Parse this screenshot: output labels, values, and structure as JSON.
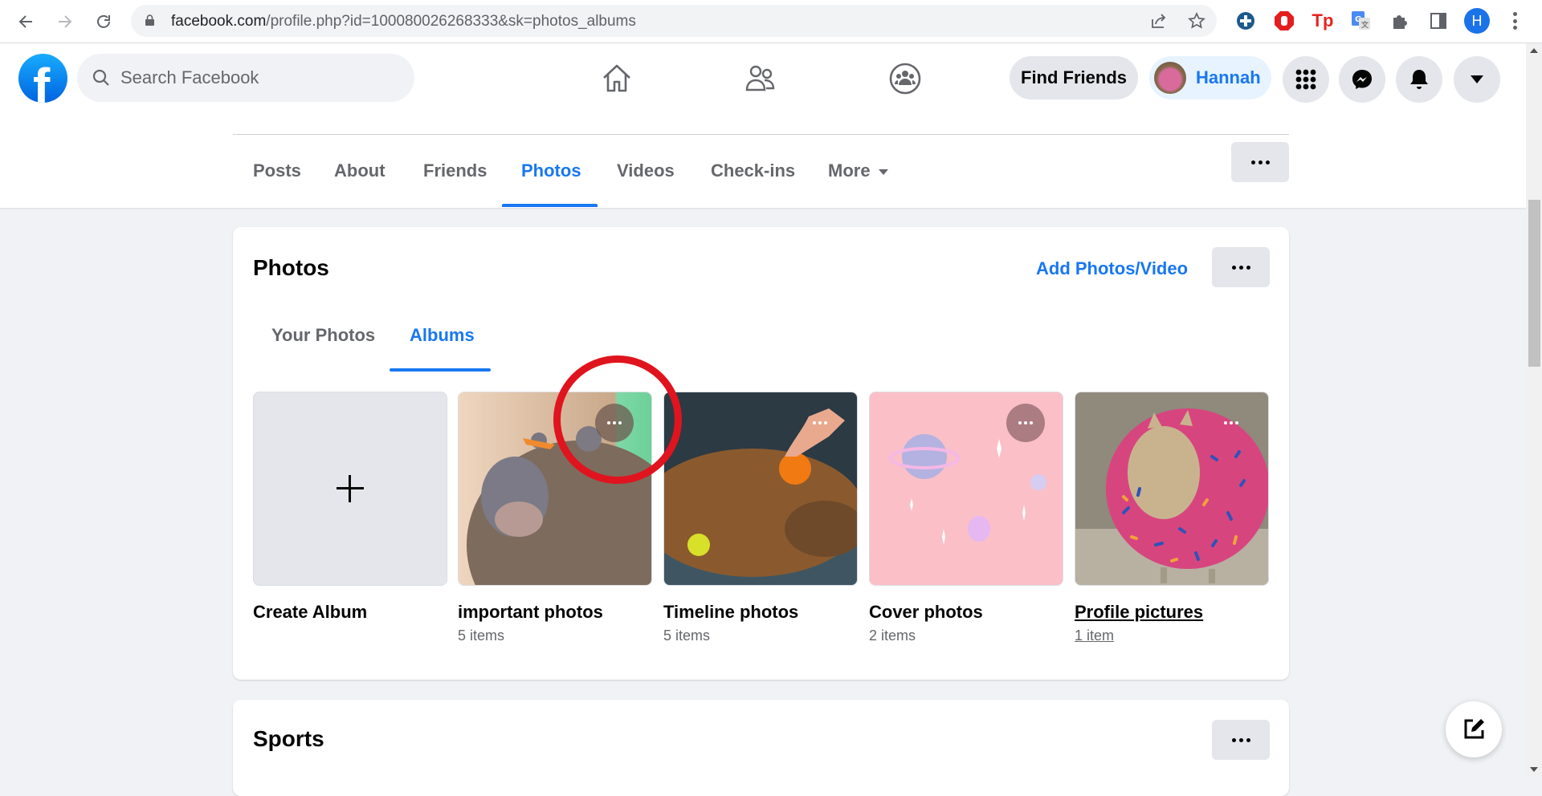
{
  "browser": {
    "url_host": "facebook.com",
    "url_path": "/profile.php?id=100080026268333&sk=photos_albums",
    "profile_initial": "H",
    "extensions": [
      "game-controller-extension",
      "adblock-extension",
      "tp-extension",
      "google-translate-extension",
      "extensions-puzzle",
      "side-panel"
    ]
  },
  "header": {
    "search_placeholder": "Search Facebook",
    "find_friends_label": "Find Friends",
    "user_name": "Hannah",
    "nav_icons": [
      "home-icon",
      "friends-icon",
      "groups-icon"
    ],
    "right_icons": [
      "menu-grid-icon",
      "messenger-icon",
      "notifications-bell-icon",
      "account-caret-icon"
    ]
  },
  "profile_tabs": {
    "items": [
      {
        "label": "Posts",
        "active": false
      },
      {
        "label": "About",
        "active": false
      },
      {
        "label": "Friends",
        "active": false
      },
      {
        "label": "Photos",
        "active": true
      },
      {
        "label": "Videos",
        "active": false
      },
      {
        "label": "Check-ins",
        "active": false
      },
      {
        "label": "More",
        "active": false
      }
    ]
  },
  "photos_card": {
    "title": "Photos",
    "add_link": "Add Photos/Video",
    "subtabs": [
      {
        "label": "Your Photos",
        "active": false
      },
      {
        "label": "Albums",
        "active": true
      }
    ],
    "albums": [
      {
        "name": "Create Album",
        "count": ""
      },
      {
        "name": "important photos",
        "count": "5 items"
      },
      {
        "name": "Timeline photos",
        "count": "5 items"
      },
      {
        "name": "Cover photos",
        "count": "2 items"
      },
      {
        "name": "Profile pictures",
        "count": "1 item"
      }
    ]
  },
  "sports_card": {
    "title": "Sports"
  },
  "colors": {
    "accent": "#1877f2",
    "annotation_circle": "#e0141e",
    "background": "#f0f2f5"
  }
}
